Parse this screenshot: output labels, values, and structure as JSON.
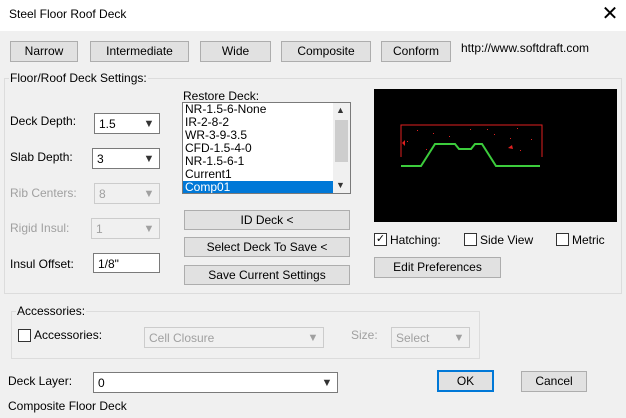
{
  "window": {
    "title": "Steel Floor Roof Deck",
    "close_glyph": "✕"
  },
  "presets": [
    "Narrow",
    "Intermediate",
    "Wide",
    "Composite",
    "Conform"
  ],
  "website": "http://www.softdraft.com",
  "settings": {
    "group_label": "Floor/Roof Deck Settings:",
    "deck_depth": {
      "label": "Deck Depth:",
      "value": "1.5"
    },
    "slab_depth": {
      "label": "Slab Depth:",
      "value": "3"
    },
    "rib_centers": {
      "label": "Rib Centers:",
      "value": "8"
    },
    "rigid_insul": {
      "label": "Rigid Insul:",
      "value": "1"
    },
    "insul_offset": {
      "label": "Insul Offset:",
      "value": "1/8\""
    }
  },
  "restore": {
    "label": "Restore Deck:",
    "items": [
      "NR-1.5-6-None",
      "IR-2-8-2",
      "WR-3-9-3.5",
      "CFD-1.5-4-0",
      "NR-1.5-6-1",
      "Current1",
      "Comp01"
    ],
    "selected_index": 6
  },
  "actions": {
    "id_deck": "ID Deck <",
    "select_deck": "Select Deck To Save <",
    "save_settings": "Save Current Settings"
  },
  "options": {
    "hatching": {
      "label": "Hatching:",
      "checked": true
    },
    "side_view": {
      "label": "Side View",
      "checked": false
    },
    "metric": {
      "label": "Metric",
      "checked": false
    }
  },
  "edit_preferences": "Edit Preferences",
  "accessories": {
    "group_label": "Accessories:",
    "checkbox_label": "Accessories:",
    "checked": false,
    "type_value": "Cell Closure",
    "size_label": "Size:",
    "size_value": "Select"
  },
  "deck_layer": {
    "label": "Deck Layer:",
    "value": "0"
  },
  "ok": "OK",
  "cancel": "Cancel",
  "status": "Composite Floor Deck",
  "colors": {
    "accent": "#0078d7",
    "preview_bg": "#000000",
    "profile": "#3ccc3c",
    "hatch": "#e02020"
  }
}
